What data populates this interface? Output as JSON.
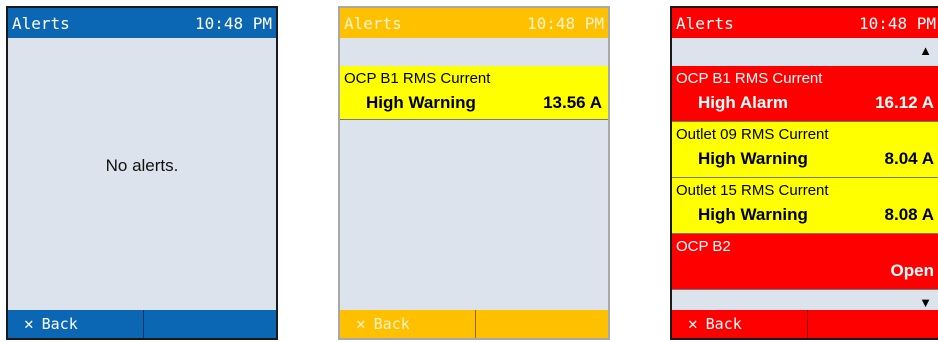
{
  "screens": [
    {
      "title": "Alerts",
      "time": "10:48 PM",
      "message": "No alerts.",
      "back_label": "Back",
      "theme_color": "#0b66b4"
    },
    {
      "title": "Alerts",
      "time": "10:48 PM",
      "back_label": "Back",
      "theme_color": "#ffc000",
      "alerts": [
        {
          "name": "OCP B1 RMS Current",
          "level": "High Warning",
          "value": "13.56 A",
          "color": "#ffff00"
        }
      ]
    },
    {
      "title": "Alerts",
      "time": "10:48 PM",
      "back_label": "Back",
      "theme_color": "#ff0000",
      "scroll_up_icon": "▲",
      "scroll_down_icon": "▼",
      "alerts": [
        {
          "name": "OCP B1 RMS Current",
          "level": "High Alarm",
          "value": "16.12 A",
          "color": "#ff0000"
        },
        {
          "name": "Outlet 09 RMS Current",
          "level": "High Warning",
          "value": "8.04 A",
          "color": "#ffff00"
        },
        {
          "name": "Outlet 15 RMS Current",
          "level": "High Warning",
          "value": "8.08 A",
          "color": "#ffff00"
        },
        {
          "name": "OCP B2",
          "level": "",
          "value": "Open",
          "color": "#ff0000"
        }
      ]
    }
  ],
  "icons": {
    "close": "✕"
  }
}
